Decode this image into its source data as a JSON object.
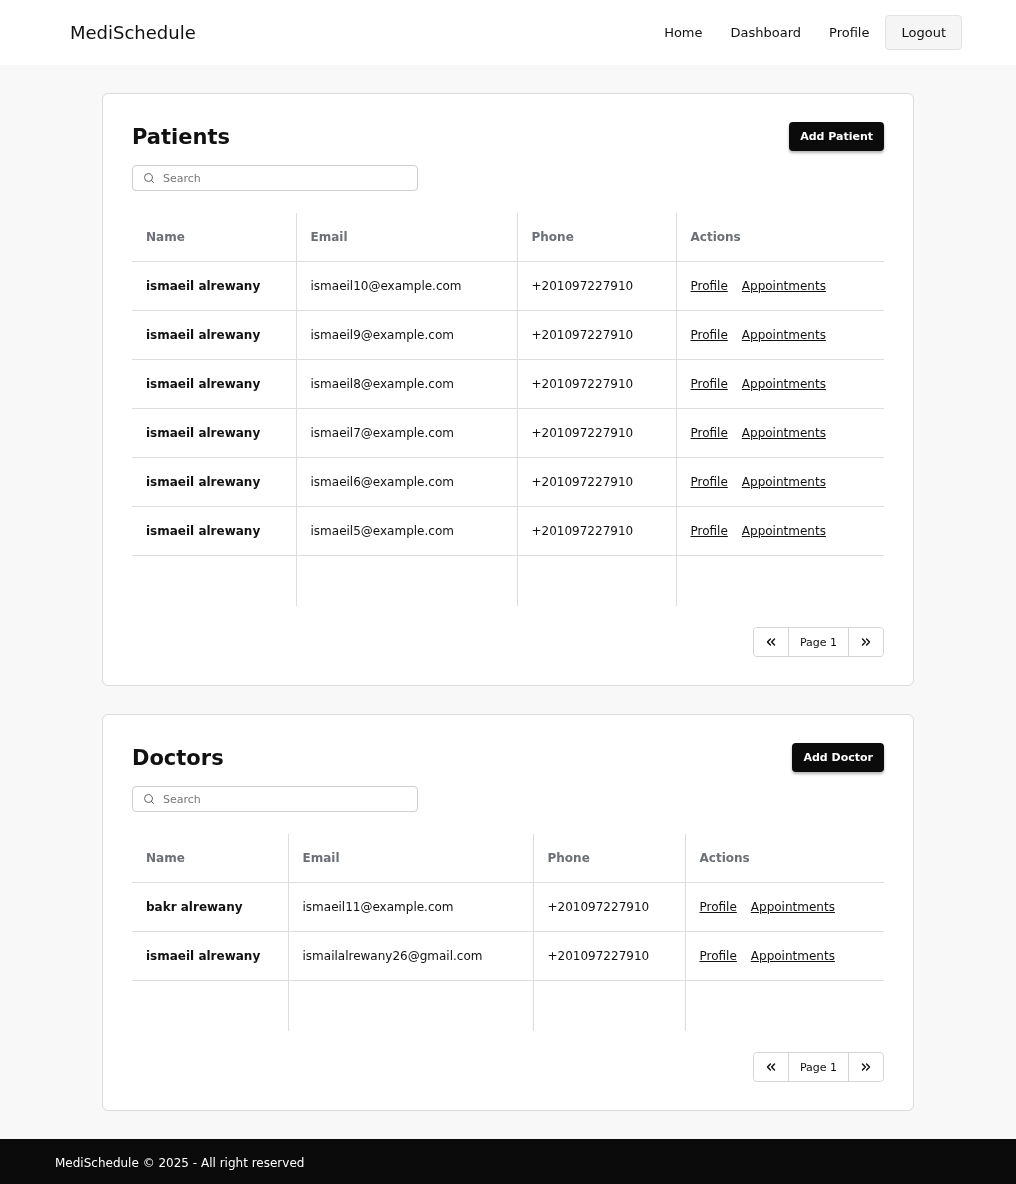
{
  "header": {
    "brand": "MediSchedule",
    "nav": [
      {
        "label": "Home",
        "kind": "link"
      },
      {
        "label": "Dashboard",
        "kind": "link"
      },
      {
        "label": "Profile",
        "kind": "link"
      },
      {
        "label": "Logout",
        "kind": "button"
      }
    ]
  },
  "sections": [
    {
      "title": "Patients",
      "add_button": "Add Patient",
      "search": {
        "placeholder": "Search"
      },
      "columns": [
        "Name",
        "Email",
        "Phone",
        "Actions"
      ],
      "rows": [
        {
          "name": "ismaeil alrewany",
          "email": "ismaeil10@example.com",
          "phone": "+201097227910",
          "actions": [
            "Profile",
            "Appointments"
          ]
        },
        {
          "name": "ismaeil alrewany",
          "email": "ismaeil9@example.com",
          "phone": "+201097227910",
          "actions": [
            "Profile",
            "Appointments"
          ]
        },
        {
          "name": "ismaeil alrewany",
          "email": "ismaeil8@example.com",
          "phone": "+201097227910",
          "actions": [
            "Profile",
            "Appointments"
          ]
        },
        {
          "name": "ismaeil alrewany",
          "email": "ismaeil7@example.com",
          "phone": "+201097227910",
          "actions": [
            "Profile",
            "Appointments"
          ]
        },
        {
          "name": "ismaeil alrewany",
          "email": "ismaeil6@example.com",
          "phone": "+201097227910",
          "actions": [
            "Profile",
            "Appointments"
          ]
        },
        {
          "name": "ismaeil alrewany",
          "email": "ismaeil5@example.com",
          "phone": "+201097227910",
          "actions": [
            "Profile",
            "Appointments"
          ]
        }
      ],
      "page": "Page 1"
    },
    {
      "title": "Doctors",
      "add_button": "Add Doctor",
      "search": {
        "placeholder": "Search"
      },
      "columns": [
        "Name",
        "Email",
        "Phone",
        "Actions"
      ],
      "rows": [
        {
          "name": "bakr alrewany",
          "email": "ismaeil11@example.com",
          "phone": "+201097227910",
          "actions": [
            "Profile",
            "Appointments"
          ]
        },
        {
          "name": "ismaeil alrewany",
          "email": "ismailalrewany26@gmail.com",
          "phone": "+201097227910",
          "actions": [
            "Profile",
            "Appointments"
          ]
        }
      ],
      "page": "Page 1"
    }
  ],
  "footer": "MediSchedule © 2025 - All right reserved"
}
